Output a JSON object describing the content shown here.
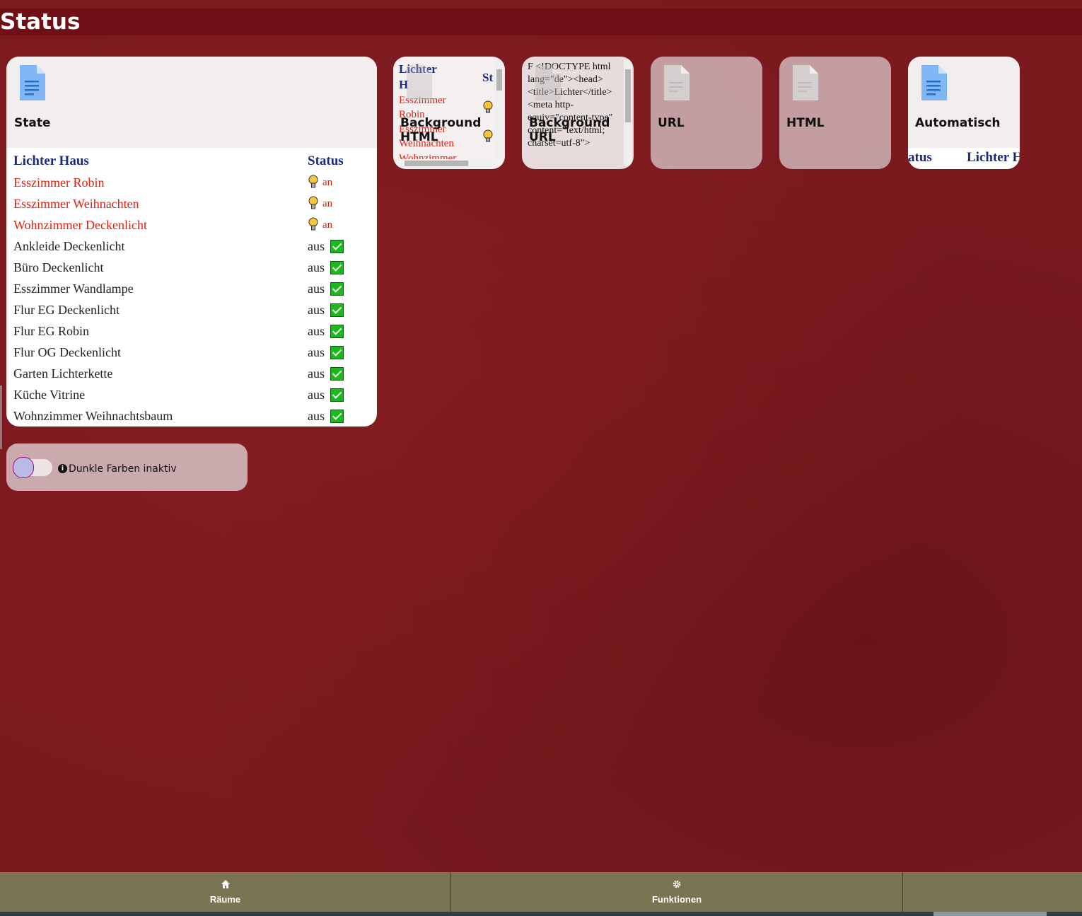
{
  "page": {
    "title": "Status"
  },
  "state_tile": {
    "label": "State",
    "table": {
      "header_name": "Lichter Haus",
      "header_status": "Status",
      "rows": [
        {
          "name": "Esszimmer Robin",
          "status": "an",
          "on": true
        },
        {
          "name": "Esszimmer Weihnachten",
          "status": "an",
          "on": true
        },
        {
          "name": "Wohnzimmer Deckenlicht",
          "status": "an",
          "on": true
        },
        {
          "name": "Ankleide Deckenlicht",
          "status": "aus",
          "on": false
        },
        {
          "name": "Büro Deckenlicht",
          "status": "aus",
          "on": false
        },
        {
          "name": "Esszimmer Wandlampe",
          "status": "aus",
          "on": false
        },
        {
          "name": "Flur EG Deckenlicht",
          "status": "aus",
          "on": false
        },
        {
          "name": "Flur EG Robin",
          "status": "aus",
          "on": false
        },
        {
          "name": "Flur OG Deckenlicht",
          "status": "aus",
          "on": false
        },
        {
          "name": "Garten Lichterkette",
          "status": "aus",
          "on": false
        },
        {
          "name": "Küche Vitrine",
          "status": "aus",
          "on": false
        },
        {
          "name": "Wohnzimmer Weihnachtsbaum",
          "status": "aus",
          "on": false
        }
      ]
    }
  },
  "tiles": {
    "background_html": {
      "label": "Background HTML",
      "preview_header_1": "Lichter",
      "preview_header_2": "H",
      "preview_status": "St",
      "preview_row_1a": "Esszimmer",
      "preview_row_1b": "Robin",
      "preview_row_2a": "Esszimmer",
      "preview_row_2b": "Weihnachten",
      "preview_row_3": "Wohnzimmer"
    },
    "background_url": {
      "label": "Background URL",
      "preview_text": "F <!DOCTYPE html lang=\"de\"><head> <title>Lichter</title> <meta http-equiv=\"content-type\" content=\"text/html; charset=utf-8\">"
    },
    "url": {
      "label": "URL"
    },
    "html": {
      "label": "HTML"
    },
    "automatisch": {
      "label": "Automatisch",
      "preview_status": "atus",
      "preview_title": "Lichter H"
    }
  },
  "dark_mode": {
    "label": "Dunkle Farben inaktiv",
    "info_icon": "i"
  },
  "footer": {
    "nav": [
      {
        "label": "Räume",
        "icon": "home-icon"
      },
      {
        "label": "Funktionen",
        "icon": "gear-icon"
      }
    ]
  },
  "colors": {
    "on": "#e02010",
    "header": "#1a2a80",
    "footer": "#7a7452"
  }
}
